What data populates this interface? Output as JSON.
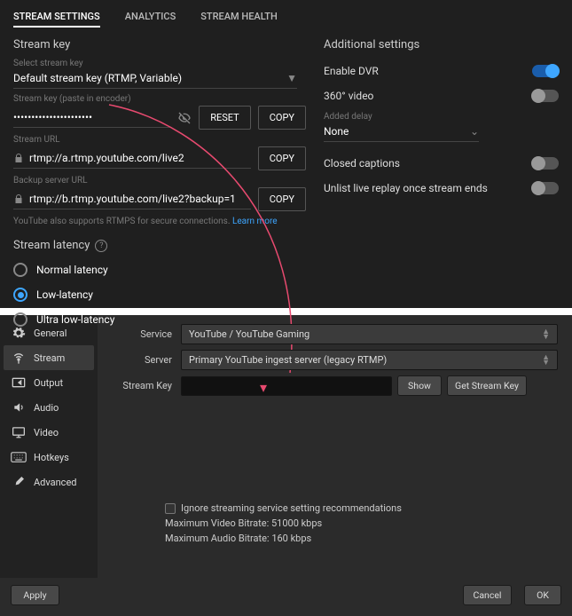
{
  "yt": {
    "tabs": {
      "settings": "STREAM SETTINGS",
      "analytics": "ANALYTICS",
      "health": "STREAM HEALTH"
    },
    "left": {
      "section": "Stream key",
      "select_label": "Select stream key",
      "select_value": "Default stream key (RTMP, Variable)",
      "key_label": "Stream key (paste in encoder)",
      "key_value": "••••••••••••••••••••••",
      "reset": "RESET",
      "copy": "COPY",
      "url_label": "Stream URL",
      "url_value": "rtmp://a.rtmp.youtube.com/live2",
      "backup_label": "Backup server URL",
      "backup_value": "rtmp://b.rtmp.youtube.com/live2?backup=1",
      "helper_text": "YouTube also supports RTMPS for secure connections. ",
      "helper_link": "Learn more"
    },
    "latency": {
      "title": "Stream latency",
      "normal": "Normal latency",
      "low": "Low-latency",
      "ultra": "Ultra low-latency",
      "selected": "low"
    },
    "right": {
      "section": "Additional settings",
      "dvr": "Enable DVR",
      "v360": "360° video",
      "delay_label": "Added delay",
      "delay_value": "None",
      "captions": "Closed captions",
      "unlist": "Unlist live replay once stream ends",
      "toggles": {
        "dvr": true,
        "v360": false,
        "captions": false,
        "unlist": false
      }
    }
  },
  "obs": {
    "sidebar": {
      "general": "General",
      "stream": "Stream",
      "output": "Output",
      "audio": "Audio",
      "video": "Video",
      "hotkeys": "Hotkeys",
      "advanced": "Advanced"
    },
    "form": {
      "service_label": "Service",
      "service_value": "YouTube / YouTube Gaming",
      "server_label": "Server",
      "server_value": "Primary YouTube ingest server (legacy RTMP)",
      "key_label": "Stream Key",
      "key_value": "",
      "show": "Show",
      "get_key": "Get Stream Key",
      "ignore": "Ignore streaming service setting recommendations",
      "max_video": "Maximum Video Bitrate: 51000 kbps",
      "max_audio": "Maximum Audio Bitrate: 160 kbps"
    },
    "footer": {
      "apply": "Apply",
      "cancel": "Cancel",
      "ok": "OK"
    }
  }
}
